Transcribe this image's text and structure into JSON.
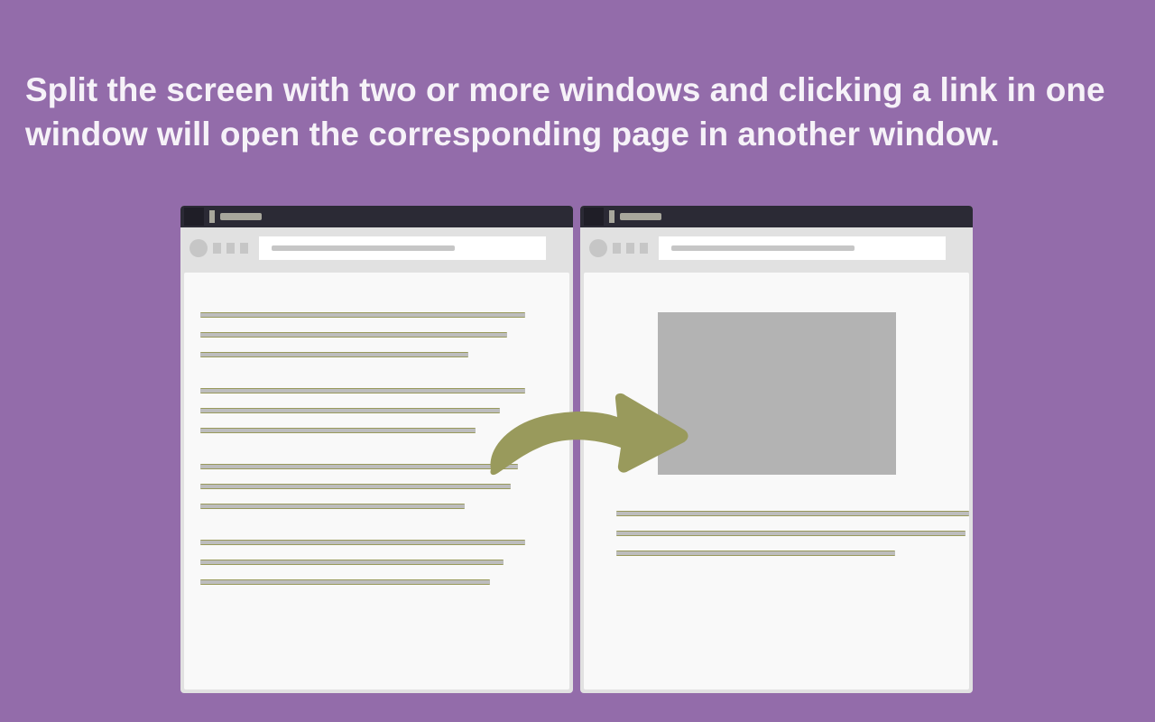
{
  "headline": "Split the screen with two or more windows and clicking a link in one window will open the corresponding page in another window.",
  "colors": {
    "background": "#936CAA",
    "titlebar": "#2B2A35",
    "toolbar": "#E1E1E1",
    "page": "#F9F9F9",
    "arrow": "#999A5C",
    "link_border": "#999A5C",
    "placeholder": "#BDBDBD"
  },
  "left_window": {
    "links": [
      {
        "width_pct": 92
      },
      {
        "width_pct": 87
      },
      {
        "width_pct": 76
      },
      {
        "gap": true
      },
      {
        "width_pct": 92
      },
      {
        "width_pct": 85
      },
      {
        "width_pct": 78
      },
      {
        "gap": true
      },
      {
        "width_pct": 90
      },
      {
        "width_pct": 88
      },
      {
        "width_pct": 75
      },
      {
        "gap": true
      },
      {
        "width_pct": 92
      },
      {
        "width_pct": 86
      },
      {
        "width_pct": 82
      }
    ]
  },
  "right_window": {
    "has_image": true,
    "links": [
      {
        "width_pct": 100
      },
      {
        "width_pct": 99
      },
      {
        "width_pct": 79
      }
    ]
  }
}
